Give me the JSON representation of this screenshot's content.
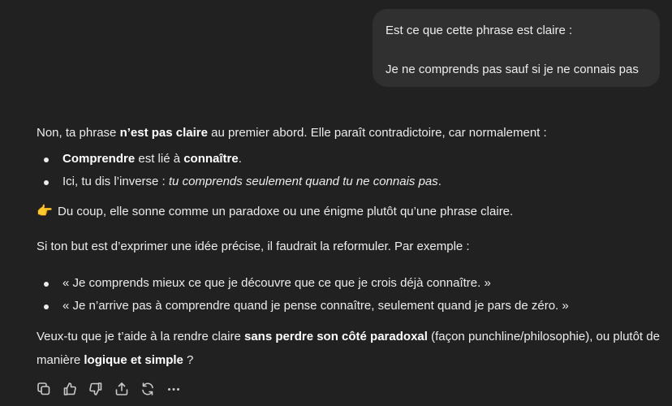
{
  "user_message": {
    "line1": "Est ce que cette phrase est claire :",
    "line2": "Je ne comprends pas sauf si je ne connais pas"
  },
  "assistant": {
    "intro": {
      "t1": "Non, ta phrase ",
      "b1": "n’est pas claire",
      "t2": " au premier abord. Elle paraît contradictoire, car normalement :"
    },
    "list1": [
      {
        "b": "Comprendre",
        "t1": " est lié à ",
        "b2": "connaître",
        "t2": "."
      },
      {
        "t1": "Ici, tu dis l’inverse : ",
        "i": "tu comprends seulement quand tu ne connais pas",
        "t2": "."
      }
    ],
    "coup": {
      "emoji": "👉",
      "text": "Du coup, elle sonne comme un paradoxe ou une énigme plutôt qu’une phrase claire."
    },
    "but": "Si ton but est d’exprimer une idée précise, il faudrait la reformuler. Par exemple :",
    "list2": [
      "« Je comprends mieux ce que je découvre que ce que je crois déjà connaître. »",
      "« Je n’arrive pas à comprendre quand je pense connaître, seulement quand je pars de zéro. »"
    ],
    "veux": {
      "t1": "Veux-tu que je t’aide à la rendre claire ",
      "b1": "sans perdre son côté paradoxal",
      "t2": " (façon punchline/philosophie), ou plutôt de manière ",
      "b2": "logique et simple",
      "t3": " ?"
    }
  },
  "actions": [
    {
      "icon": "copy-icon"
    },
    {
      "icon": "thumbs-up-icon"
    },
    {
      "icon": "thumbs-down-icon"
    },
    {
      "icon": "share-icon"
    },
    {
      "icon": "regenerate-icon"
    },
    {
      "icon": "more-icon"
    }
  ],
  "colors": {
    "background": "#212121",
    "bubble": "#303030",
    "text": "#ececec"
  }
}
